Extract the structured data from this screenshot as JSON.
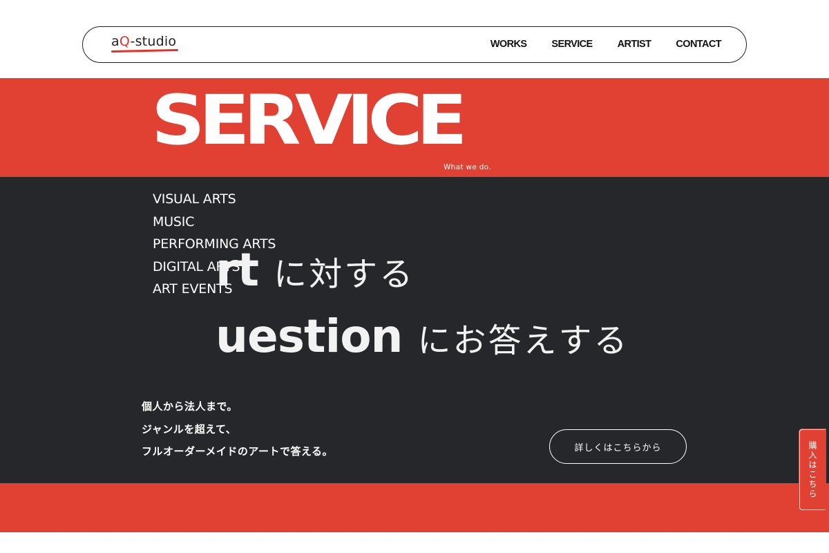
{
  "header": {
    "logo_prefix": "a",
    "logo_q": "Q",
    "logo_suffix": "-studio",
    "nav": [
      "WORKS",
      "SERVICE",
      "ARTIST",
      "CONTACT"
    ]
  },
  "service": {
    "title": "SERVICE",
    "subtitle": "What we do.",
    "categories": [
      "VISUAL ARTS",
      "MUSIC",
      "PERFORMING ARTS",
      "DIGITAL ARTS",
      "ART EVENTS"
    ]
  },
  "hero": {
    "line1_big": "rt",
    "line1_jp": "に対する",
    "line2_big": "uestion",
    "line2_jp": "にお答えする"
  },
  "description": [
    "個人から法人まで。",
    "ジャンルを超えて、",
    "フルオーダーメイドのアートで答える。"
  ],
  "cta": {
    "detail_label": "詳しくはこちらから"
  },
  "side_tab": {
    "label": "購入はこちら"
  },
  "colors": {
    "accent_red": "#e04133",
    "dark": "#26272b"
  }
}
